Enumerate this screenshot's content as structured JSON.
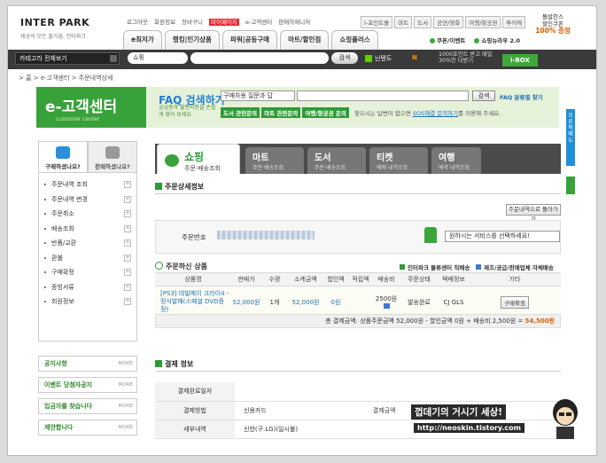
{
  "header": {
    "logo_text": "INTER PARK",
    "logo_sub": "세상의 모든 즐거움, 인터파크",
    "top_links": [
      "로그아웃",
      "회원정보",
      "장바구니",
      "마이페이지",
      "e-고객센터",
      "판매자매니저"
    ],
    "mypage_label": "마이페이지",
    "top_links_right": [
      "I-포인트몰",
      "마트",
      "도서",
      "공연/영화",
      "여행/항공권",
      "투어캐"
    ],
    "promo": [
      "돌발찬스",
      "할인쿠폰",
      "100% 증정"
    ],
    "nav_tabs": [
      "e최저가",
      "랭킹|인기상품",
      "파워|공동구매",
      "마트/할인점",
      "쇼핑플러스"
    ],
    "nav_extra": [
      "쿠폰/이벤트",
      "쇼핑뉴라우 2.0"
    ]
  },
  "searchbar": {
    "category_label": "카테고리 전체보기",
    "shop_select": "쇼핑",
    "search_button": "검색",
    "keyword_label": "닌텐도",
    "n_mark": "N",
    "point_text": "1000포인트 받고 매일 30%인 더받기",
    "ibox": "i-BOX"
  },
  "breadcrumb": "> 홈 > e-고객센터 > 주문내역상세",
  "hero": {
    "title": "e-고객센터",
    "subtitle": "customer center",
    "faq_title": "FAQ 검색하기",
    "faq_select": "구매자용 질문과 답",
    "faq_button": "검색",
    "faq_link": "FAQ 분류별 찾기",
    "sub_text": "궁금증과 불편사항을 손쉽게 찾아 보세요.",
    "quick": [
      "도서 관련문의",
      "마트 관련문의",
      "여행/항공권 문의"
    ],
    "note_prefix": "찾으시는 답변이 없으면",
    "note_link": "SOS해결 문의하기",
    "note_suffix": "를 이용해 주세요."
  },
  "side_tab": "오른쪽 메뉴",
  "left": {
    "tab_buy": "구매하셨나요?",
    "tab_sell": "판매하셨나요?",
    "menu": [
      "주문내역 조회",
      "주문내역 변경",
      "주문취소",
      "배송조회",
      "반품/교환",
      "환불",
      "구매확정",
      "증빙서류",
      "회원정보"
    ],
    "boxes": [
      "공지사항",
      "이벤트 당첨자공지",
      "입금자를 찾습니다",
      "제안합니다"
    ],
    "more": "MORE"
  },
  "main_tabs": [
    {
      "title": "쇼핑",
      "sub": "주문·배송조회"
    },
    {
      "title": "마트",
      "sub": "주문·배송조회"
    },
    {
      "title": "도서",
      "sub": "주문·배송조회"
    },
    {
      "title": "티켓",
      "sub": "예매 내역조회"
    },
    {
      "title": "여행",
      "sub": "예약 내역조회"
    }
  ],
  "order": {
    "section_title": "주문상세정보",
    "back_button": "주문내역으로 돌아가기",
    "order_no_label": "주문번호",
    "service_select": "원하시는 서비스를 선택하세요!",
    "cancel_title": "주문하신 상품",
    "legend": [
      "인터파크 물류센터 직배송",
      "제조/공급/판매업체 자체배송"
    ],
    "legend_colors": [
      "#2f9a37",
      "#3a7ad0"
    ],
    "columns": [
      "상품명",
      "판매가",
      "수량",
      "소계금액",
      "할인액",
      "적립액",
      "배송비",
      "주문상태",
      "택배정보",
      "기타"
    ],
    "row": {
      "name": "[PS3] 데빌메이 크라이4 - 정식발매(스페셜 DVD증정)",
      "price": "52,000원",
      "qty": "1개",
      "subtotal": "52,000원",
      "discount": "0원",
      "points": "",
      "shipping": "2500원",
      "status": "발송완료",
      "carrier": "CJ GLS",
      "action": "구매확정"
    },
    "total_prefix": "총 결제금액: 상품주문금액 52,000원 - 할인금액 0원 + 배송비 2,500원 =",
    "total_value": "54,500원"
  },
  "payment": {
    "section_title": "결제 정보",
    "rows": [
      {
        "label": "결제완료일자",
        "value": ""
      },
      {
        "label": "결제방법",
        "value": "신용카드"
      },
      {
        "label": "세부내역",
        "value": "신한(구.LG)(일시불)"
      }
    ],
    "right_label": "결제금액"
  },
  "watermark": {
    "line1": "껍데기의 거시기 세상!",
    "line2": "http://neoskin.tistory.com"
  }
}
